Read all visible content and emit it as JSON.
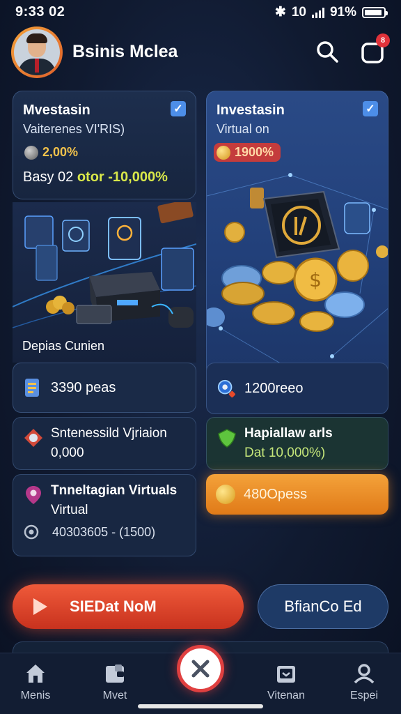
{
  "status_bar": {
    "time": "9:33 02",
    "signal_text": "10",
    "battery_percent": "91%",
    "battery_level": 0.91
  },
  "header": {
    "title": "Bsinis Mclea",
    "notification_count": "8"
  },
  "card_left": {
    "title": "Mvestasin",
    "subtitle": "Vaiterenes VI'RIS)",
    "rate": "2,00%",
    "range_prefix": "Basy 02",
    "range_highlight": "otor -10,000%",
    "illustration_label": "Depias Cunien"
  },
  "card_right": {
    "title": "Investasin",
    "subtitle": "Virtual on",
    "rate": "1900%"
  },
  "stat_left": {
    "text": "3390 peas"
  },
  "stat_right": {
    "text": "1200reeo"
  },
  "info_1": {
    "line1": "Sntenessild Vjriaion",
    "line2": "0,000"
  },
  "info_2": {
    "line1": "Hapiallaw arls",
    "line2": "Dat 10,000%)"
  },
  "info_3": {
    "line1": "Tnneltagian Virtuals",
    "line2": "Virtual",
    "line3": "40303605 - (1500)"
  },
  "orange_button": {
    "label": "480Opess"
  },
  "cta": {
    "primary": "SIEDat NoM",
    "secondary": "BfianCo Ed"
  },
  "nav": {
    "items": [
      {
        "label": "Menis",
        "icon": "home-icon"
      },
      {
        "label": "Mvet",
        "icon": "wallet-icon"
      },
      {
        "label": "Vitenan",
        "icon": "folder-icon"
      },
      {
        "label": "Espei",
        "icon": "profile-icon"
      }
    ],
    "center_icon": "close-icon"
  },
  "colors": {
    "accent_orange": "#e07a18",
    "accent_red": "#e04040",
    "highlight_yellow": "#d9e84a",
    "card_blue": "#2a4a86"
  }
}
